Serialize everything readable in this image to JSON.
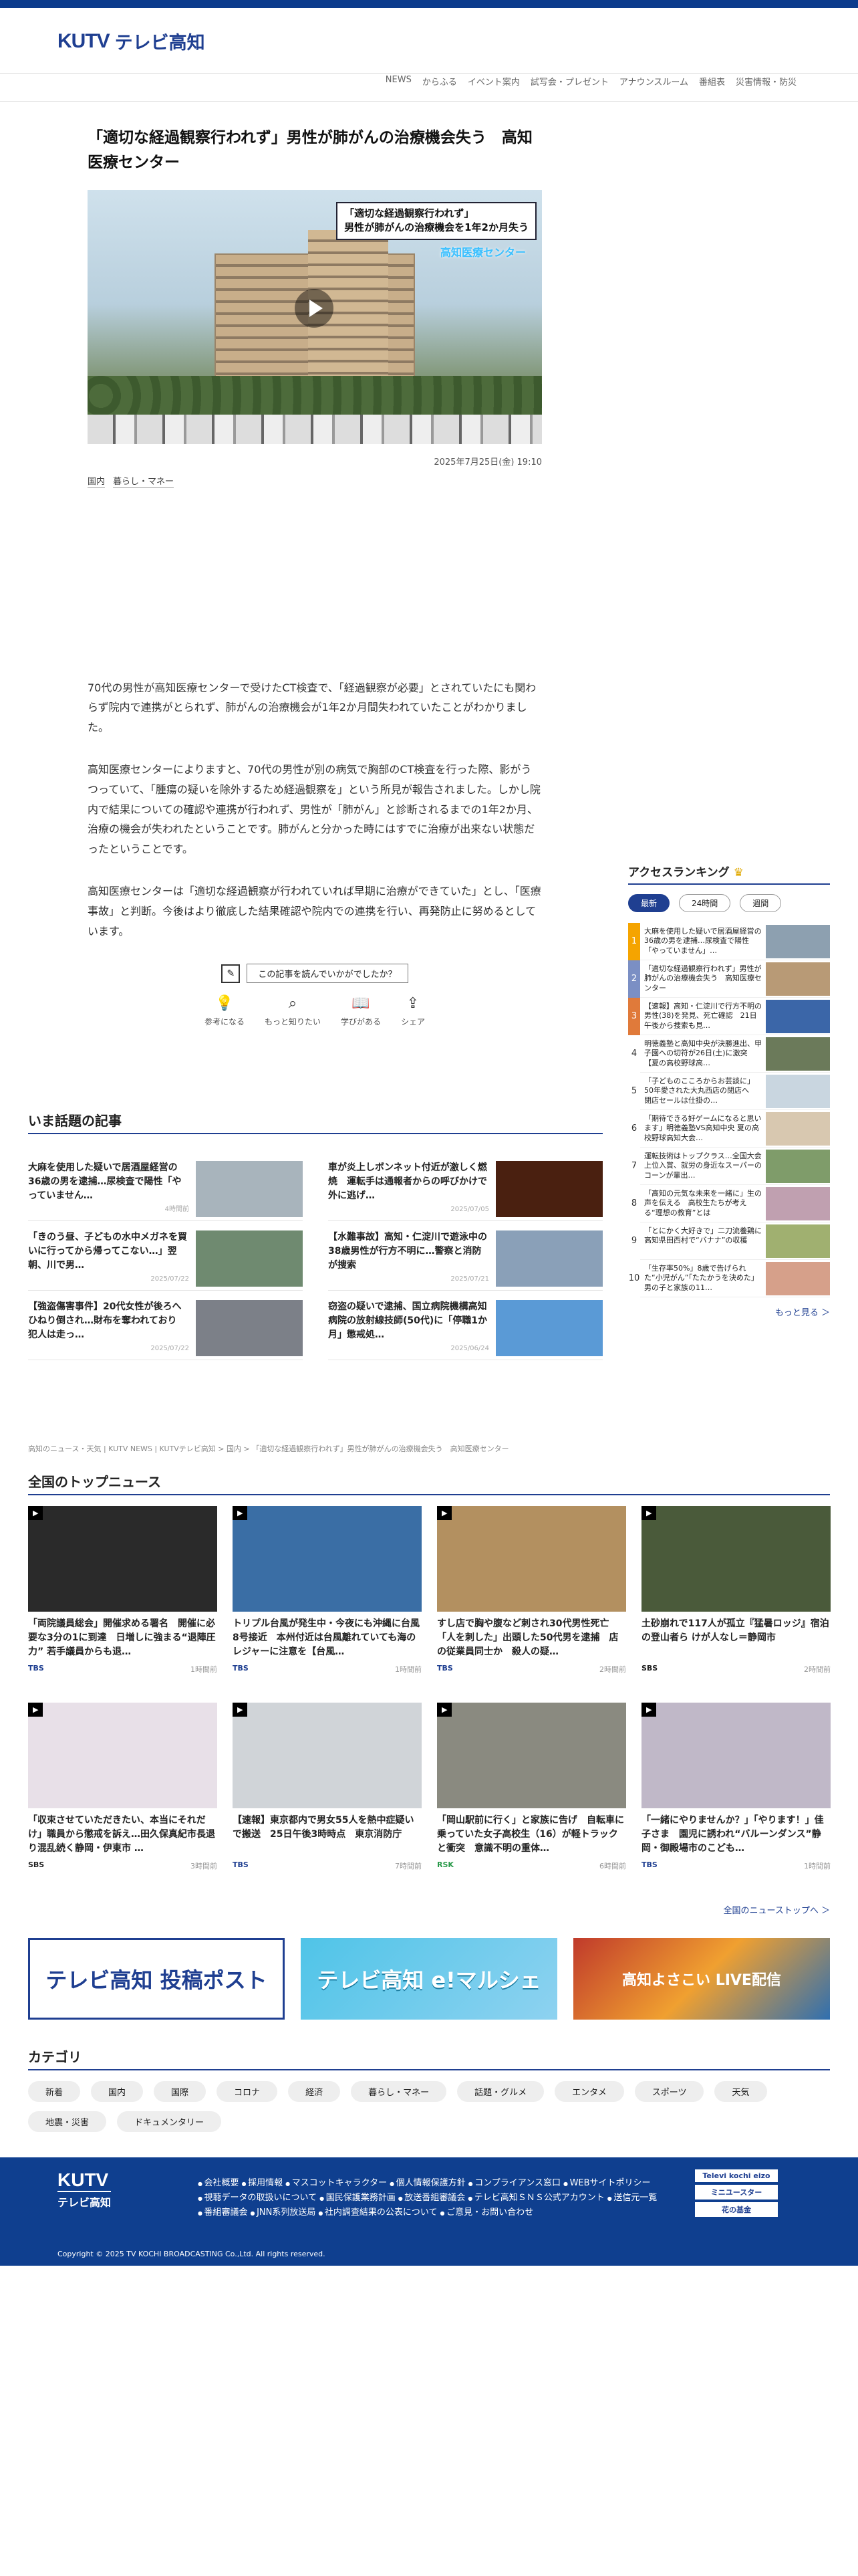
{
  "header": {
    "logo_kutv": "KUTV",
    "logo_jp": "テレビ高知"
  },
  "gnav": [
    "NEWS",
    "からふる",
    "イベント案内",
    "試写会・プレゼント",
    "アナウンスルーム",
    "番組表",
    "災害情報・防災"
  ],
  "article": {
    "title": "「適切な経過観察行われず」男性が肺がんの治療機会失う　高知医療センター",
    "image_caption": [
      "「適切な経過観察行われず」",
      "男性が肺がんの治療機会を1年2か月失う"
    ],
    "image_sub": "高知医療センター",
    "date": "2025年7月25日(金) 19:10",
    "tags": [
      "国内",
      "暮らし・マネー"
    ],
    "paragraphs": [
      "70代の男性が高知医療センターで受けたCT検査で、「経過観察が必要」とされていたにも関わらず院内で連携がとられず、肺がんの治療機会が1年2か月間失われていたことがわかりました。",
      "高知医療センターによりますと、70代の男性が別の病気で胸部のCT検査を行った際、影がうつっていて、「腫瘍の疑いを除外するため経過観察を」という所見が報告されました。しかし院内で結果についての確認や連携が行われず、男性が「肺がん」と診断されるまでの1年2か月、治療の機会が失われたということです。肺がんと分かった時にはすでに治療が出来ない状態だったということです。",
      "高知医療センターは「適切な経過観察が行われていれば早期に治療ができていた」とし、「医療事故」と判断。今後はより徹底した結果確認や院内での連携を行い、再発防止に努めるとしています。"
    ],
    "reaction_q": "この記事を読んでいかがでしたか？",
    "reactions": [
      "参考になる",
      "もっと知りたい",
      "学びがある",
      "シェア"
    ]
  },
  "ranking": {
    "title": "アクセスランキング",
    "tabs": [
      "最新",
      "24時間",
      "週間"
    ],
    "items": [
      {
        "n": "1",
        "t": "大麻を使用した疑いで居酒屋経営の36歳の男を逮捕…尿検査で陽性「やっていません」…"
      },
      {
        "n": "2",
        "t": "「適切な経過観察行われず」男性が肺がんの治療機会失う　高知医療センター"
      },
      {
        "n": "3",
        "t": "【速報】高知・仁淀川で行方不明の男性(38)を発見、死亡確認　21日午後から捜索も見…"
      },
      {
        "n": "4",
        "t": "明徳義塾と高知中央が決勝進出、甲子園への切符が26日(土)に激突【夏の高校野球高…"
      },
      {
        "n": "5",
        "t": "「子どものこころからお芸談に」50年愛された大丸西店の閉店へ　閉店セールは仕掛の…"
      },
      {
        "n": "6",
        "t": "「期待できる好ゲームになると思います」明徳義塾VS高知中央 夏の高校野球高知大会…"
      },
      {
        "n": "7",
        "t": "運転技術はトップクラス…全国大会上位入賞、就労の身近なスーパーのコーンが輩出…"
      },
      {
        "n": "8",
        "t": "「高知の元気な未来を一緒に」生の声を伝える　高校生たちが考える“理想の教育”とは"
      },
      {
        "n": "9",
        "t": "「とにかく大好きで」二刀流養鶏に　高知県田西村で“バナナ”の収穫"
      },
      {
        "n": "10",
        "t": "「生存率50%」8歳で告げられた“小児がん”「たたかうを決めた」男の子と家族の11…"
      }
    ],
    "more": "もっと見る ＞"
  },
  "topics": {
    "title": "いま話題の記事",
    "items": [
      {
        "t": "大麻を使用した疑いで居酒屋経営の36歳の男を逮捕…尿検査で陽性「やっていません…",
        "d": "4時間前"
      },
      {
        "t": "車が炎上しボンネット付近が激しく燃焼　運転手は通報者からの呼びかけで外に逃げ…",
        "d": "2025/07/05"
      },
      {
        "t": "「きのう昼、子どもの水中メガネを買いに行ってから帰ってこない…」翌朝、川で男…",
        "d": "2025/07/22"
      },
      {
        "t": "【水難事故】高知・仁淀川で遊泳中の38歳男性が行方不明に…警察と消防が捜索",
        "d": "2025/07/21"
      },
      {
        "t": "【強盗傷害事件】20代女性が後ろへひねり倒され…財布を奪われており　犯人は走っ…",
        "d": "2025/07/22"
      },
      {
        "t": "窃盗の疑いで逮捕、国立病院機構高知病院の放射線技師(50代)に「停職1か月」懲戒処…",
        "d": "2025/06/24"
      }
    ]
  },
  "breadcrumb": "高知のニュース・天気 | KUTV NEWS | KUTVテレビ高知 > 国内 > 「適切な経過観察行われず」男性が肺がんの治療機会失う　高知医療センター",
  "national": {
    "title": "全国のトップニュース",
    "items": [
      {
        "t": "「両院議員総会」開催求める署名　開催に必要な3分の1に到達　日増しに強まる“退陣圧力” 若手議員からも退…",
        "src": "TBS",
        "ago": "1時間前"
      },
      {
        "t": "トリプル台風が発生中・今夜にも沖縄に台風8号接近　本州付近は台風離れていても海のレジャーに注意を【台風…",
        "src": "TBS",
        "ago": "1時間前"
      },
      {
        "t": "すし店で胸や腹など刺され30代男性死亡「人を刺した」出頭した50代男を逮捕　店の従業員同士か　殺人の疑…",
        "src": "TBS",
        "ago": "2時間前"
      },
      {
        "t": "土砂崩れで117人が孤立『猛暑ロッジ』宿泊の登山者ら けが人なし＝静岡市",
        "src": "SBS",
        "ago": "2時間前"
      },
      {
        "t": "「収束させていただきたい、本当にそれだけ」職員から懲戒を訴え…田久保真紀市長退り混乱続く静岡・伊東市 …",
        "src": "SBS",
        "ago": "3時間前"
      },
      {
        "t": "【速報】東京都内で男女55人を熱中症疑いで搬送　25日午後3時時点　東京消防庁",
        "src": "TBS",
        "ago": "7時間前"
      },
      {
        "t": "「岡山駅前に行く」と家族に告げ　自転車に乗っていた女子高校生（16）が軽トラックと衝突　意識不明の重体…",
        "src": "RSK",
        "ago": "6時間前"
      },
      {
        "t": "「一緒にやりませんか？」「やります！」佳子さま　園児に誘われ“バルーンダンス”静岡・御殿場市のこども…",
        "src": "TBS",
        "ago": "1時間前"
      }
    ],
    "more": "全国のニューストップへ ＞"
  },
  "banners": [
    "テレビ高知 投稿ポスト",
    "テレビ高知 e!マルシェ",
    "高知よさこい LIVE配信"
  ],
  "categories": {
    "title": "カテゴリ",
    "items": [
      "新着",
      "国内",
      "国際",
      "コロナ",
      "経済",
      "暮らし・マネー",
      "話題・グルメ",
      "エンタメ",
      "スポーツ",
      "天気",
      "地震・災害",
      "ドキュメンタリー"
    ]
  },
  "footer": {
    "logo_a": "KUTV",
    "logo_b": "テレビ高知",
    "links": [
      "会社概要",
      "採用情報",
      "マスコットキャラクター",
      "個人情報保護方針",
      "コンプライアンス窓口",
      "WEBサイトポリシー",
      "視聴データの取扱いについて",
      "国民保護業務計画",
      "放送番組審議会",
      "テレビ高知ＳＮＳ公式アカウント",
      "送信元一覧",
      "番組審議会",
      "JNN系列放送局",
      "社内調査結果の公表について",
      "ご意見・お問い合わせ"
    ],
    "side": [
      "Televi kochi eizo",
      "ミニユースター",
      "花の基金"
    ],
    "copyright": "Copyright © 2025 TV KOCHI BROADCASTING Co.,Ltd. All rights reserved."
  },
  "colors": {
    "brand": "#1f3f91",
    "footer": "#0f3f8f"
  }
}
